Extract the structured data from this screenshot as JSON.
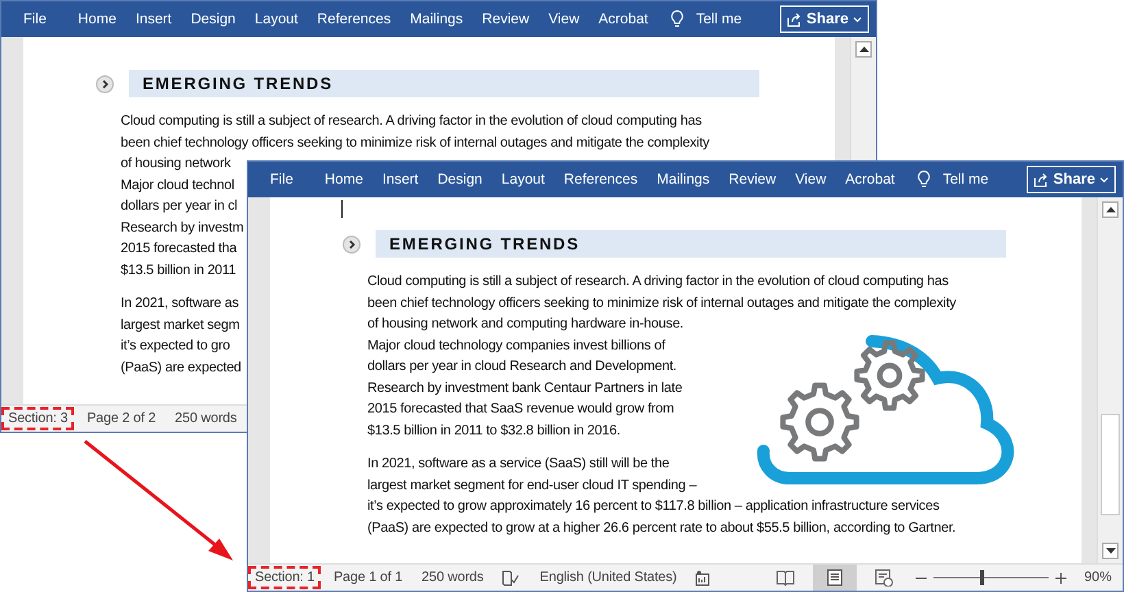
{
  "windows": [
    {
      "menu": [
        "File",
        "Home",
        "Insert",
        "Design",
        "Layout",
        "References",
        "Mailings",
        "Review",
        "View",
        "Acrobat"
      ],
      "tell_me": "Tell me",
      "share": "Share",
      "heading": "EMERGING TRENDS",
      "paragraphs": [
        [
          "Cloud computing is still a subject of research. A driving factor in the evolution of cloud computing has",
          "been chief technology officers seeking to minimize risk of internal outages and mitigate the complexity",
          "of housing network",
          "Major cloud technol",
          "dollars per year in cl",
          "Research by investm",
          "2015 forecasted tha",
          "$13.5 billion in 2011"
        ],
        [
          "In 2021, software as",
          "largest market segm",
          "it’s expected to gro",
          "(PaaS) are expected"
        ]
      ],
      "status": [
        {
          "text": "Section: 3",
          "highlighted": true
        },
        {
          "text": "Page 2 of 2",
          "highlighted": false
        },
        {
          "text": "250 words",
          "highlighted": false
        }
      ]
    },
    {
      "menu": [
        "File",
        "Home",
        "Insert",
        "Design",
        "Layout",
        "References",
        "Mailings",
        "Review",
        "View",
        "Acrobat"
      ],
      "tell_me": "Tell me",
      "share": "Share",
      "heading": "EMERGING TRENDS",
      "paragraphs": [
        [
          "Cloud computing is still a subject of research. A driving factor in the evolution of cloud computing has",
          "been chief technology officers seeking to minimize risk of internal outages and mitigate the complexity",
          "of housing network and computing hardware in-house.",
          "Major cloud technology companies invest billions of",
          "dollars per year in cloud Research and Development.",
          "Research by investment bank Centaur Partners in late",
          "2015 forecasted that SaaS revenue would grow from",
          "$13.5 billion in 2011 to $32.8 billion in 2016."
        ],
        [
          "In 2021, software as a service (SaaS) still will be the",
          "largest market segment for end-user cloud IT spending –",
          "it’s expected to grow approximately 16 percent to $117.8 billion – application infrastructure services",
          "(PaaS) are expected to grow at a higher 26.6 percent rate to about $55.5 billion, according to Gartner."
        ]
      ],
      "status": [
        {
          "text": "Section: 1",
          "highlighted": true
        },
        {
          "text": "Page 1 of 1",
          "highlighted": false
        },
        {
          "text": "250 words",
          "highlighted": false
        }
      ],
      "language": "English (United States)",
      "views": [
        {
          "kind": "read",
          "selected": false
        },
        {
          "kind": "print",
          "selected": true
        },
        {
          "kind": "web",
          "selected": false
        }
      ],
      "zoom": {
        "level": 0.42,
        "reading": "90%"
      }
    }
  ]
}
